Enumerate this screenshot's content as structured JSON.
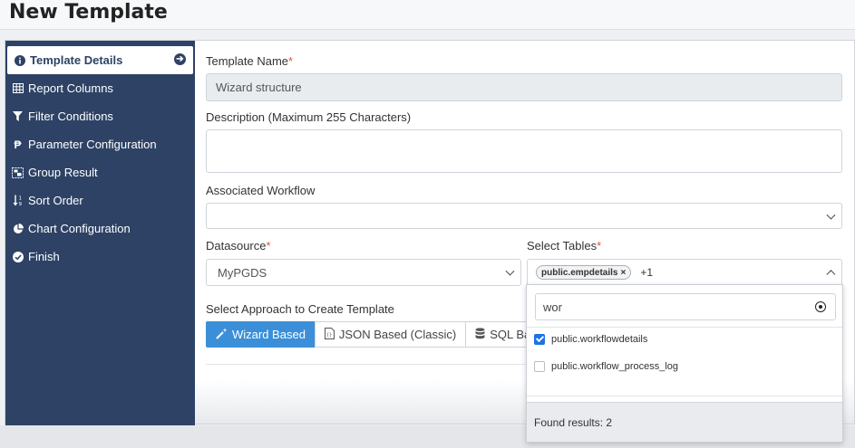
{
  "page": {
    "title": "New Template"
  },
  "sidebar": {
    "items": [
      {
        "label": "Template Details",
        "icon": "info-circle-icon",
        "active": true
      },
      {
        "label": "Report Columns",
        "icon": "table-icon"
      },
      {
        "label": "Filter Conditions",
        "icon": "filter-icon"
      },
      {
        "label": "Parameter Configuration",
        "icon": "parameter-icon"
      },
      {
        "label": "Group Result",
        "icon": "group-icon"
      },
      {
        "label": "Sort Order",
        "icon": "sort-icon"
      },
      {
        "label": "Chart Configuration",
        "icon": "pie-chart-icon"
      },
      {
        "label": "Finish",
        "icon": "check-circle-icon"
      }
    ]
  },
  "form": {
    "template_name": {
      "label": "Template Name",
      "required_mark": "*",
      "value": "Wizard structure"
    },
    "description": {
      "label": "Description (Maximum 255 Characters)",
      "value": ""
    },
    "workflow": {
      "label": "Associated Workflow",
      "value": ""
    },
    "datasource": {
      "label": "Datasource",
      "required_mark": "*",
      "value": "MyPGDS"
    },
    "tables": {
      "label": "Select Tables",
      "required_mark": "*",
      "tag": "public.empdetails",
      "tag_remove": "×",
      "more": "+1"
    },
    "approach": {
      "label": "Select Approach to Create Template",
      "buttons": [
        {
          "label": "Wizard Based",
          "icon": "magic-wand-icon",
          "active": true
        },
        {
          "label": "JSON Based (Classic)",
          "icon": "json-file-icon"
        },
        {
          "label": "SQL Based",
          "icon": "database-icon"
        }
      ]
    }
  },
  "dropdown": {
    "search_value": "wor",
    "options": [
      {
        "label": "public.workflowdetails",
        "checked": true
      },
      {
        "label": "public.workflow_process_log",
        "checked": false
      }
    ],
    "footer": "Found results: 2"
  },
  "colors": {
    "sidebar": "#2d4265",
    "primary": "#3b8fd8",
    "required": "#d9534f",
    "checkbox": "#1a73e8"
  }
}
